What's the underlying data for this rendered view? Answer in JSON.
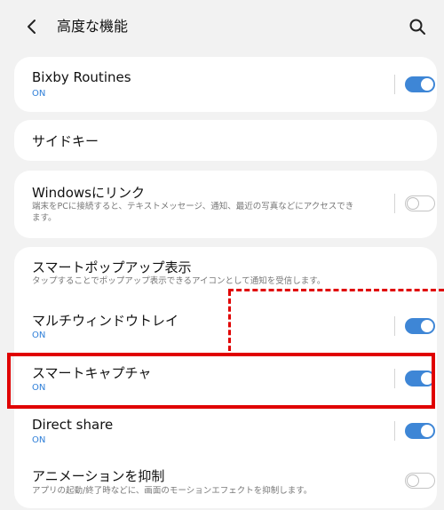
{
  "header": {
    "title": "高度な機能"
  },
  "items": [
    {
      "title": "Bixby Routines",
      "status": "ON",
      "toggle": "on"
    },
    {
      "title": "サイドキー"
    },
    {
      "title": "Windowsにリンク",
      "desc_line1": "端末をPCに接続すると、テキストメッセージ、通知、最近の写真などにアクセスでき",
      "desc_line2": "ます。",
      "toggle": "off"
    },
    {
      "title": "スマートポップアップ表示",
      "desc": "タップすることでポップアップ表示できるアイコンとして通知を受信します。"
    },
    {
      "title": "マルチウィンドウトレイ",
      "status": "ON",
      "toggle": "on"
    },
    {
      "title": "スマートキャプチャ",
      "status": "ON",
      "toggle": "on"
    },
    {
      "title": "Direct share",
      "status": "ON",
      "toggle": "on"
    },
    {
      "title": "アニメーションを抑制",
      "desc": "アプリの起動/終了時などに、画面のモーションエフェクトを抑制します。",
      "toggle": "off"
    }
  ],
  "colors": {
    "accent": "#3e86d6",
    "highlight": "#e00000",
    "background": "#f2f2f2"
  },
  "icons": {
    "back": "chevron-left-icon",
    "search": "search-icon"
  }
}
